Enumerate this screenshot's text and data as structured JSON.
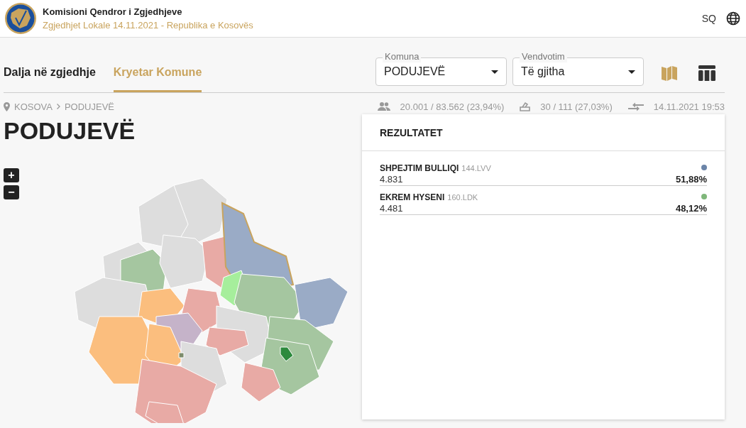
{
  "header": {
    "title": "Komisioni Qendror i Zgjedhjeve",
    "subtitle": "Zgjedhjet Lokale 14.11.2021 - Republika e Kosovës",
    "language": "SQ"
  },
  "tabs": [
    {
      "label": "Dalja në zgjedhje",
      "selected": false
    },
    {
      "label": "Kryetar Komune",
      "selected": true
    }
  ],
  "filters": [
    {
      "label": "Komuna",
      "value": "PODUJEVË"
    },
    {
      "label": "Vendvotim",
      "value": "Të gjitha"
    }
  ],
  "view_toggles": [
    {
      "kind": "map",
      "selected": true
    },
    {
      "kind": "table",
      "selected": false
    }
  ],
  "breadcrumb": [
    "KOSOVA",
    "PODUJEVË"
  ],
  "stats": [
    {
      "kind": "voters",
      "text": "20.001 / 83.562 (23,94%)"
    },
    {
      "kind": "stations",
      "text": "30 / 111 (27,03%)"
    },
    {
      "kind": "updated",
      "text": "14.11.2021 19:53"
    }
  ],
  "title": "PODUJEVË",
  "map_zoom": [
    "+",
    "−"
  ],
  "results": {
    "title": "REZULTATET",
    "candidates": [
      {
        "name": "SHPEJTIM BULLIQI",
        "party": "144.LVV",
        "votes": "4.831",
        "percent": "51,88%",
        "color": "#6b84a8"
      },
      {
        "name": "EKREM HYSENI",
        "party": "160.LDK",
        "votes": "4.481",
        "percent": "48,12%",
        "color": "#7fb77a"
      }
    ]
  }
}
